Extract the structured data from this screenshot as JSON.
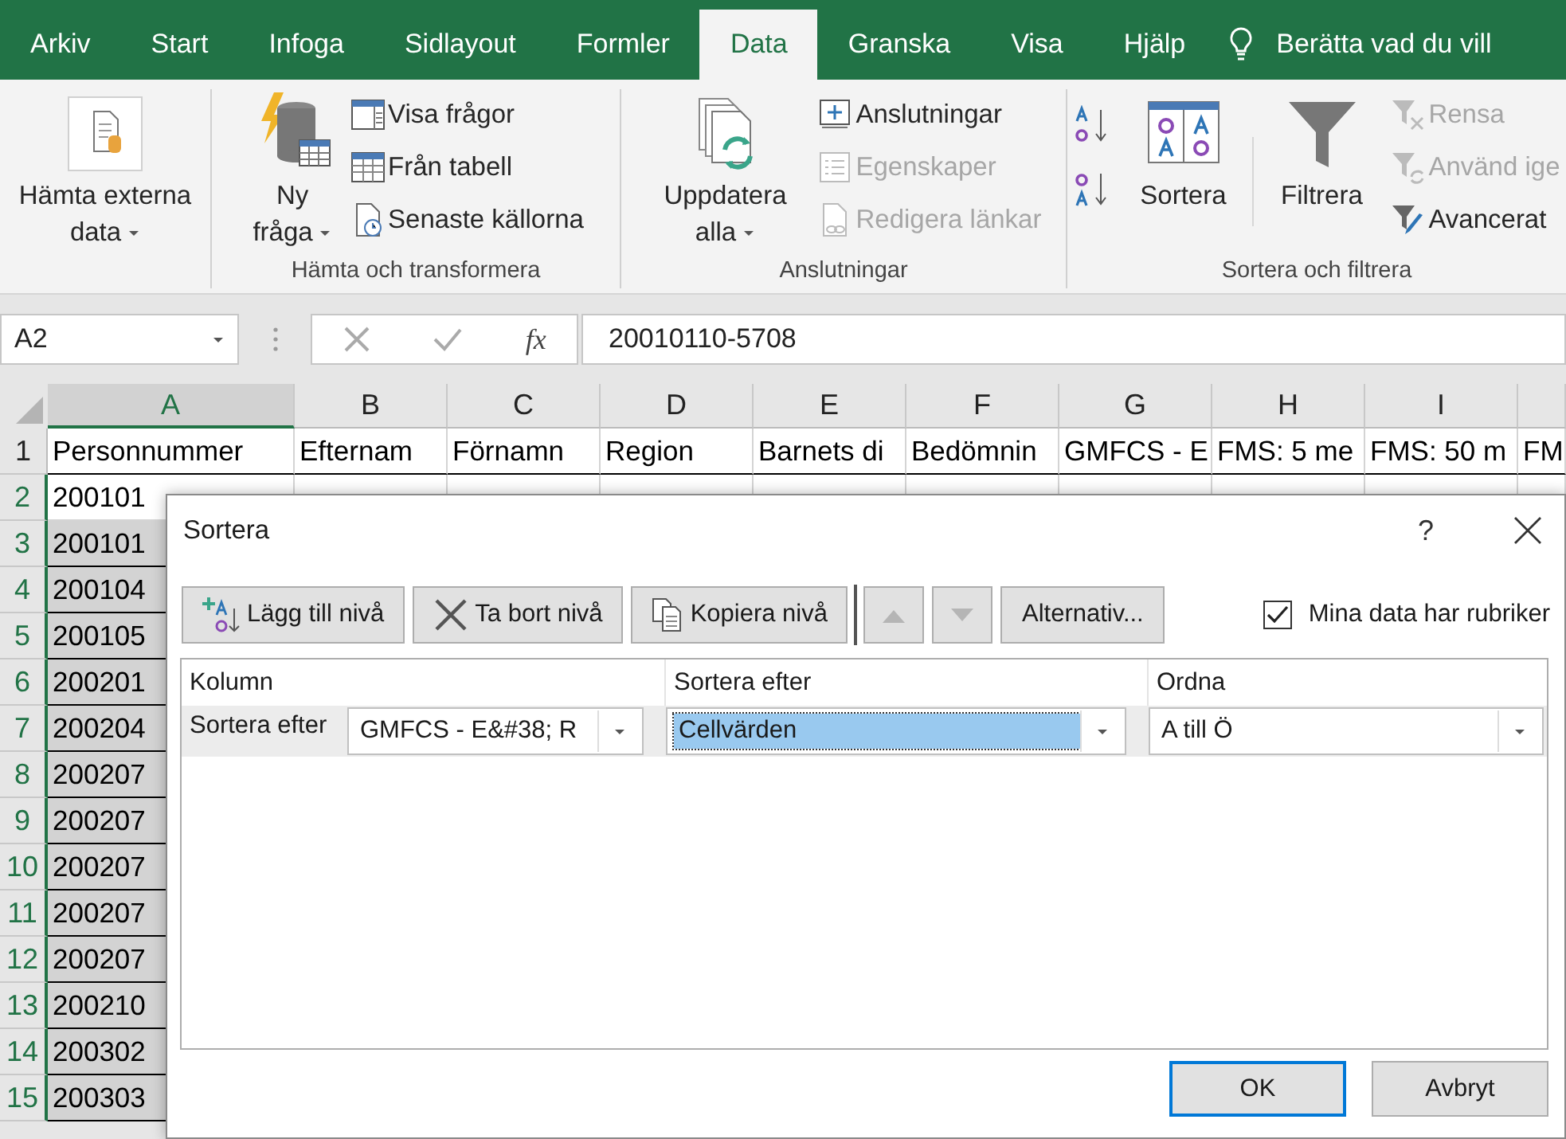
{
  "menu_tabs": [
    {
      "label": "Arkiv",
      "selected": false
    },
    {
      "label": "Start",
      "selected": false
    },
    {
      "label": "Infoga",
      "selected": false
    },
    {
      "label": "Sidlayout",
      "selected": false
    },
    {
      "label": "Formler",
      "selected": false
    },
    {
      "label": "Data",
      "selected": true
    },
    {
      "label": "Granska",
      "selected": false
    },
    {
      "label": "Visa",
      "selected": false
    },
    {
      "label": "Hjälp",
      "selected": false
    }
  ],
  "tell_me": "Berätta vad du vill",
  "ribbon": {
    "groups": [
      {
        "items": [
          {
            "kind": "large",
            "label": "Hämta externa data",
            "dropdown": true
          }
        ]
      },
      {
        "label": "Hämta och transformera",
        "items": [
          {
            "kind": "large",
            "label": "Ny fråga",
            "dropdown": true
          },
          {
            "kind": "stack",
            "items": [
              {
                "label": "Visa frågor",
                "disabled": false
              },
              {
                "label": "Från tabell",
                "disabled": false
              },
              {
                "label": "Senaste källorna",
                "disabled": false
              }
            ]
          }
        ]
      },
      {
        "label": "Anslutningar",
        "items": [
          {
            "kind": "large",
            "label": "Uppdatera alla",
            "dropdown": true
          },
          {
            "kind": "stack",
            "items": [
              {
                "label": "Anslutningar",
                "disabled": false
              },
              {
                "label": "Egenskaper",
                "disabled": true
              },
              {
                "label": "Redigera länkar",
                "disabled": true
              }
            ]
          }
        ]
      },
      {
        "label": "Sortera och filtrera",
        "items": [
          {
            "kind": "sort_icons"
          },
          {
            "kind": "large",
            "label": "Sortera",
            "dropdown": false
          },
          {
            "kind": "separator"
          },
          {
            "kind": "large",
            "label": "Filtrera",
            "dropdown": false
          },
          {
            "kind": "stack",
            "items": [
              {
                "label": "Rensa",
                "disabled": true
              },
              {
                "label": "Använd ige",
                "disabled": true
              },
              {
                "label": "Avancerat",
                "disabled": false
              }
            ]
          }
        ]
      }
    ]
  },
  "formula_bar": {
    "name_box": "A2",
    "function_label": "fx",
    "formula": "20010110-5708"
  },
  "sheet": {
    "columns": [
      "A",
      "B",
      "C",
      "D",
      "E",
      "F",
      "G",
      "H",
      "I",
      ""
    ],
    "header_row": {
      "number": "1",
      "cells": [
        "Personnummer",
        "Efternam",
        "Förnamn",
        "Region",
        "Barnets di",
        "Bedömnin",
        "GMFCS - E",
        "FMS: 5 me",
        "FMS: 50 m",
        "FM"
      ]
    },
    "rows": [
      {
        "number": "2",
        "a": "200101",
        "active": true
      },
      {
        "number": "3",
        "a": "200101",
        "active": false
      },
      {
        "number": "4",
        "a": "200104",
        "active": false
      },
      {
        "number": "5",
        "a": "200105",
        "active": false
      },
      {
        "number": "6",
        "a": "200201",
        "active": false
      },
      {
        "number": "7",
        "a": "200204",
        "active": false
      },
      {
        "number": "8",
        "a": "200207",
        "active": false
      },
      {
        "number": "9",
        "a": "200207",
        "active": false
      },
      {
        "number": "10",
        "a": "200207",
        "active": false
      },
      {
        "number": "11",
        "a": "200207",
        "active": false
      },
      {
        "number": "12",
        "a": "200207",
        "active": false
      },
      {
        "number": "13",
        "a": "200210",
        "active": false
      },
      {
        "number": "14",
        "a": "200302",
        "active": false
      },
      {
        "number": "15",
        "a": "200303",
        "active": false
      }
    ]
  },
  "dialog": {
    "title": "Sortera",
    "help": "?",
    "toolbar": [
      {
        "kind": "add",
        "label": "Lägg till nivå",
        "disabled": false
      },
      {
        "kind": "delete",
        "label": "Ta bort nivå",
        "disabled": false
      },
      {
        "kind": "copy",
        "label": "Kopiera nivå",
        "disabled": false
      },
      {
        "kind": "up",
        "disabled": true
      },
      {
        "kind": "down",
        "disabled": true
      },
      {
        "kind": "text",
        "label": "Alternativ...",
        "disabled": false
      }
    ],
    "has_headers": {
      "label": "Mina data har rubriker",
      "checked": true
    },
    "columns": [
      "Kolumn",
      "Sortera efter",
      "Ordna"
    ],
    "levels": [
      {
        "label": "Sortera efter",
        "column": "GMFCS - E&#38; R",
        "sort_on": "Cellvärden",
        "sort_on_focused": true,
        "order": "A till Ö"
      }
    ],
    "buttons": [
      {
        "label": "OK",
        "default": true
      },
      {
        "label": "Avbryt",
        "default": false
      }
    ]
  }
}
